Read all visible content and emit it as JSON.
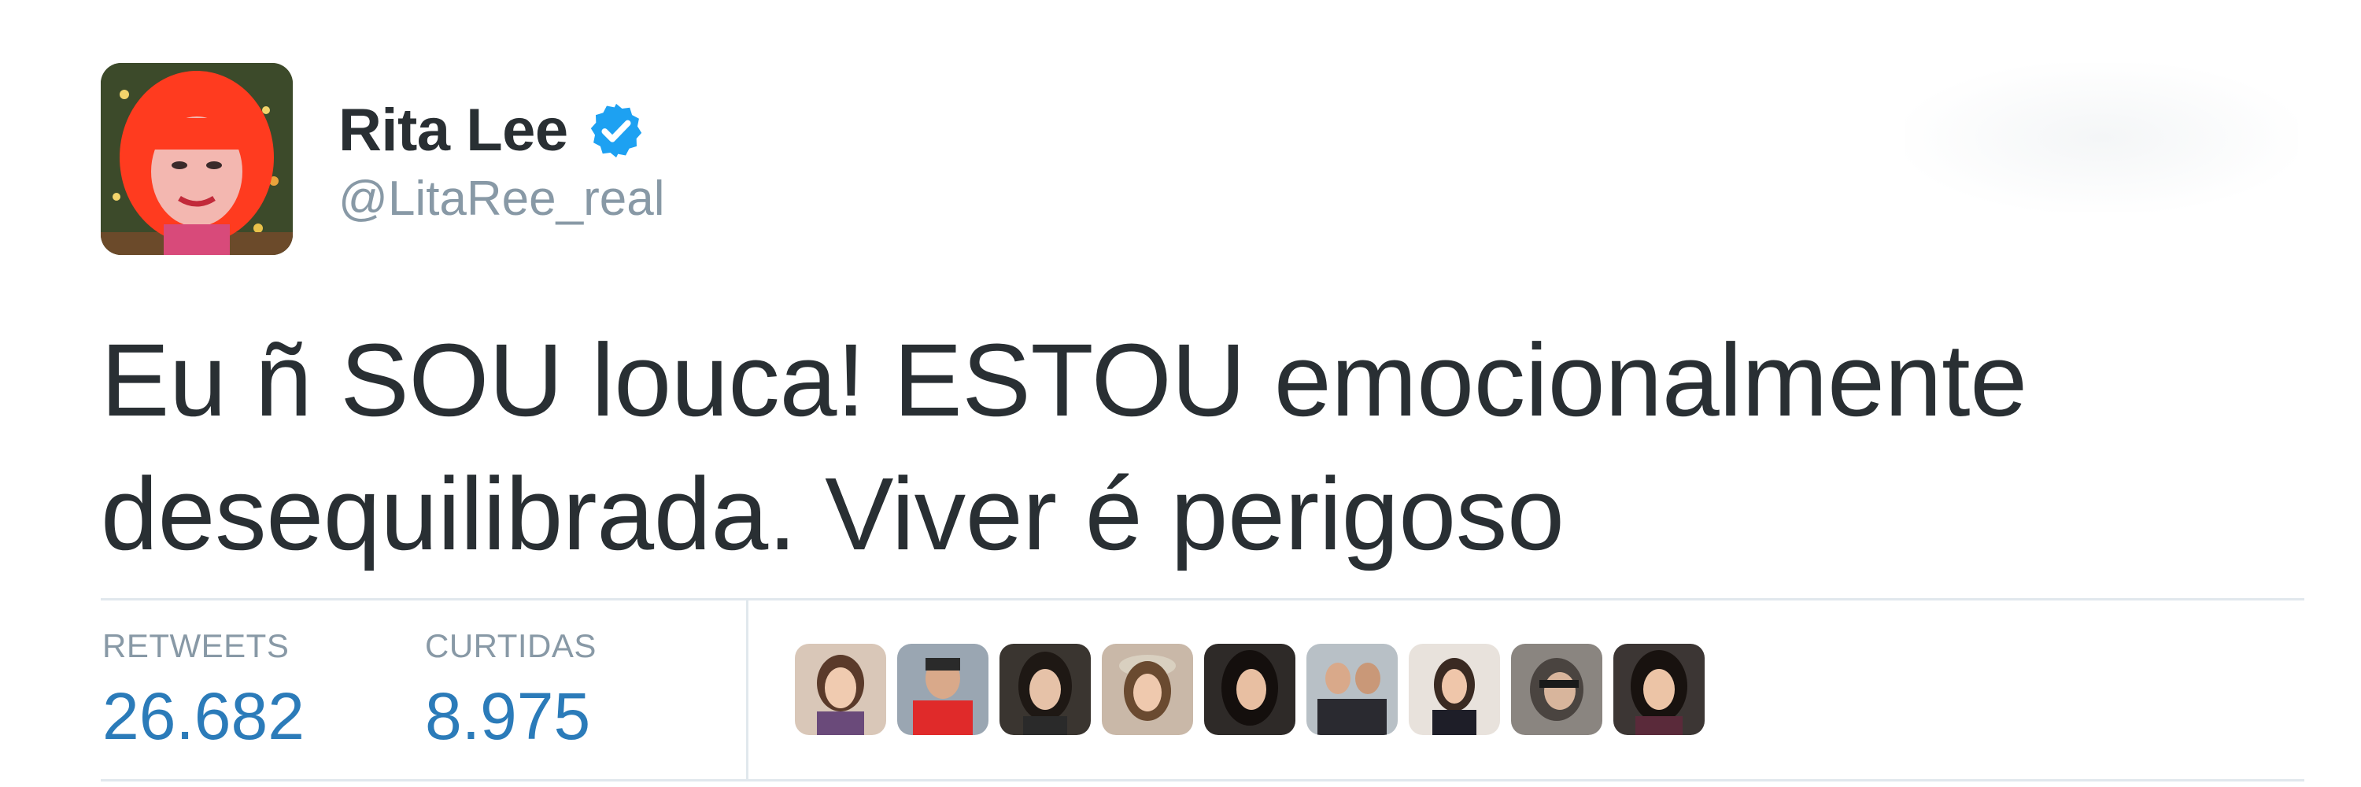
{
  "tweet": {
    "author": {
      "display_name": "Rita Lee",
      "handle": "@LitaRee_real",
      "verified": true,
      "avatar_icon": "profile-avatar-icon"
    },
    "follow_area": {
      "label": ""
    },
    "text_line1": "Eu ñ SOU louca! ESTOU emocionalmente",
    "text_line2": "desequilibrada. Viver é perigoso",
    "stats": {
      "retweets_label": "RETWEETS",
      "retweets_value": "26.682",
      "likes_label": "CURTIDAS",
      "likes_value": "8.975"
    },
    "likers": [
      {
        "icon": "liker-avatar-icon"
      },
      {
        "icon": "liker-avatar-icon"
      },
      {
        "icon": "liker-avatar-icon"
      },
      {
        "icon": "liker-avatar-icon"
      },
      {
        "icon": "liker-avatar-icon"
      },
      {
        "icon": "liker-avatar-icon"
      },
      {
        "icon": "liker-avatar-icon"
      },
      {
        "icon": "liker-avatar-icon"
      },
      {
        "icon": "liker-avatar-icon"
      }
    ]
  },
  "colors": {
    "text": "#292f33",
    "muted": "#8899a6",
    "accent": "#2b7bb9",
    "verified": "#1da1f2",
    "divider": "#e1e8ed"
  }
}
